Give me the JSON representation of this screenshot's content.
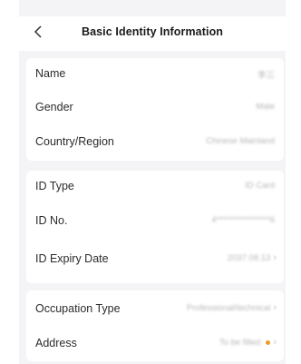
{
  "header": {
    "back_icon": "chevron-left-icon",
    "title": "Basic Identity Information"
  },
  "section1": {
    "rows": [
      {
        "label": "Name",
        "value": "李三"
      },
      {
        "label": "Gender",
        "value": "Male"
      },
      {
        "label": "Country/Region",
        "value": "Chinese Mainland"
      }
    ]
  },
  "section2": {
    "rows": [
      {
        "label": "ID Type",
        "value": "ID Card"
      },
      {
        "label": "ID No.",
        "value": "4****************6"
      },
      {
        "label": "ID Expiry Date",
        "value": "2037.08.13"
      }
    ]
  },
  "section3": {
    "rows": [
      {
        "label": "Occupation Type",
        "value": "Professional/technical"
      },
      {
        "label": "Address",
        "value": "To be filled",
        "status_color": "#f29a27"
      }
    ]
  },
  "colors": {
    "background": "#f4f4f6",
    "card": "#ffffff",
    "accent_dot": "#f29a27"
  }
}
